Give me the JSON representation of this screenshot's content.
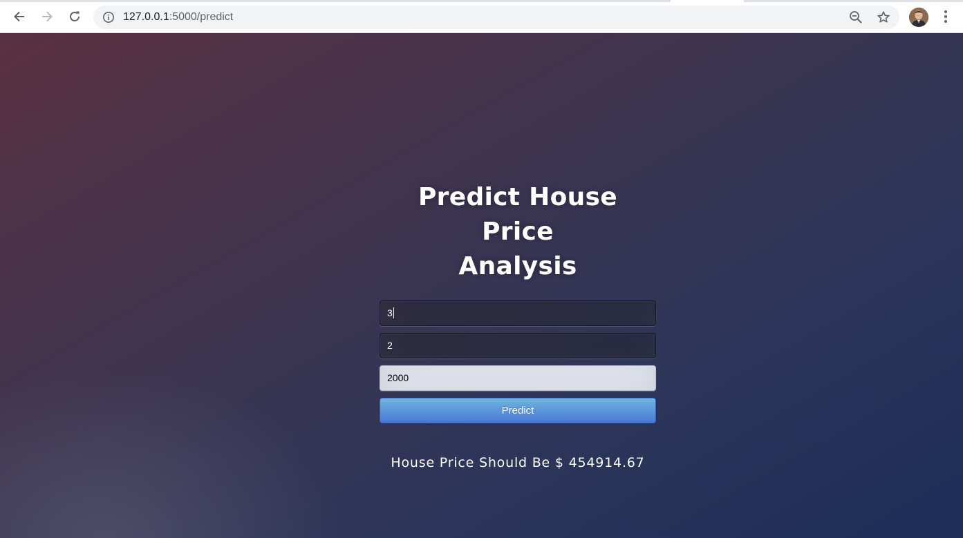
{
  "browser": {
    "url_host": "127.0.0.1",
    "url_path": ":5000/predict",
    "icons": {
      "back": "arrow-left-icon",
      "forward": "arrow-right-icon",
      "reload": "reload-icon",
      "site_info": "info-icon",
      "zoom": "zoom-out-icon",
      "bookmark": "star-icon",
      "profile": "avatar",
      "menu": "kebab-menu-icon"
    }
  },
  "page": {
    "title_line1": "Predict House Price",
    "title_line2": "Analysis",
    "fields": {
      "bedrooms_value": "3",
      "bathrooms_value": "2",
      "sqft_value": "2000"
    },
    "predict_label": "Predict",
    "result_text": "House Price Should Be $ 454914.67"
  },
  "colors": {
    "button_top": "#6eb6de",
    "button_bottom": "#4a77d4",
    "background_start": "#5a3140",
    "background_end": "#1c2d58"
  }
}
